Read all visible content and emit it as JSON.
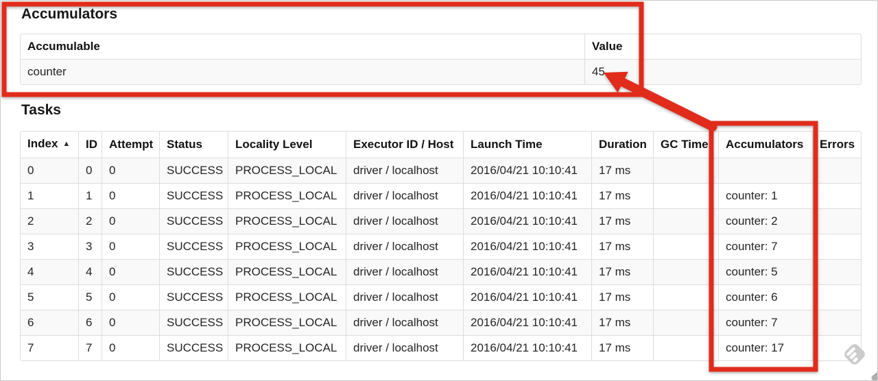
{
  "accumulators": {
    "title": "Accumulators",
    "table": {
      "headers": [
        "Accumulable",
        "Value"
      ],
      "row": {
        "name": "counter",
        "value": "45"
      }
    }
  },
  "tasks": {
    "title": "Tasks",
    "table": {
      "headers": [
        "Index",
        "ID",
        "Attempt",
        "Status",
        "Locality Level",
        "Executor ID / Host",
        "Launch Time",
        "Duration",
        "GC Time",
        "Accumulators",
        "Errors"
      ],
      "sort_icon": "▲",
      "rows": [
        [
          "0",
          "0",
          "0",
          "SUCCESS",
          "PROCESS_LOCAL",
          "driver / localhost",
          "2016/04/21 10:10:41",
          "17 ms",
          "",
          "",
          ""
        ],
        [
          "1",
          "1",
          "0",
          "SUCCESS",
          "PROCESS_LOCAL",
          "driver / localhost",
          "2016/04/21 10:10:41",
          "17 ms",
          "",
          "counter: 1",
          ""
        ],
        [
          "2",
          "2",
          "0",
          "SUCCESS",
          "PROCESS_LOCAL",
          "driver / localhost",
          "2016/04/21 10:10:41",
          "17 ms",
          "",
          "counter: 2",
          ""
        ],
        [
          "3",
          "3",
          "0",
          "SUCCESS",
          "PROCESS_LOCAL",
          "driver / localhost",
          "2016/04/21 10:10:41",
          "17 ms",
          "",
          "counter: 7",
          ""
        ],
        [
          "4",
          "4",
          "0",
          "SUCCESS",
          "PROCESS_LOCAL",
          "driver / localhost",
          "2016/04/21 10:10:41",
          "17 ms",
          "",
          "counter: 5",
          ""
        ],
        [
          "5",
          "5",
          "0",
          "SUCCESS",
          "PROCESS_LOCAL",
          "driver / localhost",
          "2016/04/21 10:10:41",
          "17 ms",
          "",
          "counter: 6",
          ""
        ],
        [
          "6",
          "6",
          "0",
          "SUCCESS",
          "PROCESS_LOCAL",
          "driver / localhost",
          "2016/04/21 10:10:41",
          "17 ms",
          "",
          "counter: 7",
          ""
        ],
        [
          "7",
          "7",
          "0",
          "SUCCESS",
          "PROCESS_LOCAL",
          "driver / localhost",
          "2016/04/21 10:10:41",
          "17 ms",
          "",
          "counter: 17",
          ""
        ]
      ]
    }
  },
  "annotations": {
    "accent_color": "#e12b1b",
    "highlighted_value": "45",
    "highlighted_column": "Accumulators"
  }
}
